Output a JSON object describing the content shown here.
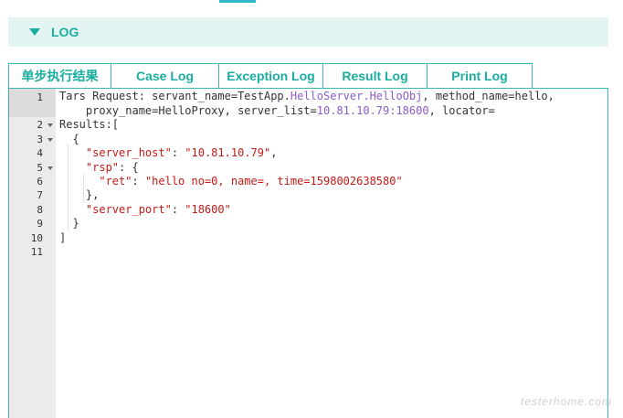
{
  "log_section": {
    "title": "LOG"
  },
  "tabs": [
    {
      "label": "单步执行结果"
    },
    {
      "label": "Case Log"
    },
    {
      "label": "Exception Log"
    },
    {
      "label": "Result Log"
    },
    {
      "label": "Print Log"
    }
  ],
  "editor": {
    "line_numbers": [
      "1",
      "2",
      "3",
      "4",
      "5",
      "6",
      "7",
      "8",
      "9",
      "10",
      "11"
    ],
    "line1": {
      "p1": "Tars Request: servant_name=",
      "p2": "TestApp.",
      "p3": "HelloServer.HelloObj",
      "p4": ", method_name=hello,",
      "p5": "    proxy_name=HelloProxy, server_list=",
      "p6": "10.81.10.79:18600",
      "p7": ", locator="
    },
    "line2": "Results:[",
    "line3": "  {",
    "line4": {
      "key": "\"server_host\"",
      "sep": ": ",
      "val": "\"10.81.10.79\"",
      "end": ","
    },
    "line5": {
      "key": "\"rsp\"",
      "sep": ": {"
    },
    "line6": {
      "key": "\"ret\"",
      "sep": ": ",
      "val": "\"hello no=0, name=, time=1598002638580\""
    },
    "line7": "    },",
    "line8": {
      "key": "\"server_port\"",
      "sep": ": ",
      "val": "\"18600\""
    },
    "line9": "  }",
    "line10": "]"
  },
  "watermark": "testerhome.com"
}
